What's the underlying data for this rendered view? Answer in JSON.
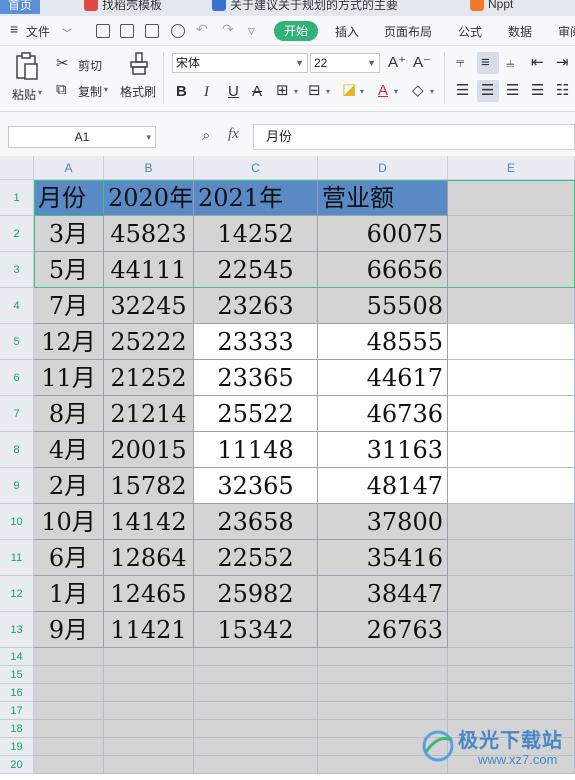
{
  "tabs": [
    {
      "label": "首页",
      "active": true
    },
    {
      "label": "找稻壳模板",
      "active": false
    },
    {
      "label": "关于建议关于规划的方式的主要",
      "active": false
    },
    {
      "label": "Nppt",
      "active": false
    }
  ],
  "menu": {
    "file_label": "文件",
    "items": [
      "开始",
      "插入",
      "页面布局",
      "公式",
      "数据",
      "审阅"
    ]
  },
  "ribbon": {
    "paste_label": "粘贴",
    "cut_label": "剪切",
    "copy_label": "复制",
    "format_painter_label": "格式刷",
    "font_name": "宋体",
    "font_size": "22",
    "bold": "B",
    "italic": "I",
    "underline": "U",
    "strike": "A",
    "font_color_glyph": "A",
    "grow_font": "A⁺",
    "shrink_font": "A⁻"
  },
  "formula_bar": {
    "cell_ref": "A1",
    "fx_label": "fx",
    "content": "月份"
  },
  "sheet": {
    "columns": [
      "A",
      "B",
      "C",
      "D",
      "E"
    ],
    "rows": [
      "1",
      "2",
      "3",
      "4",
      "5",
      "6",
      "7",
      "8",
      "9",
      "10",
      "11",
      "12",
      "13",
      "14",
      "15",
      "16",
      "17",
      "18",
      "19",
      "20"
    ],
    "header": [
      "月份",
      "2020年",
      "2021年",
      "营业额"
    ],
    "data": [
      [
        "3月",
        "45823",
        "14252",
        "60075"
      ],
      [
        "5月",
        "44111",
        "22545",
        "66656"
      ],
      [
        "7月",
        "32245",
        "23263",
        "55508"
      ],
      [
        "12月",
        "25222",
        "23333",
        "48555"
      ],
      [
        "11月",
        "21252",
        "23365",
        "44617"
      ],
      [
        "8月",
        "21214",
        "25522",
        "46736"
      ],
      [
        "4月",
        "20015",
        "11148",
        "31163"
      ],
      [
        "2月",
        "15782",
        "32365",
        "48147"
      ],
      [
        "10月",
        "14142",
        "23658",
        "37800"
      ],
      [
        "6月",
        "12864",
        "22552",
        "35416"
      ],
      [
        "1月",
        "12465",
        "25982",
        "38447"
      ],
      [
        "9月",
        "11421",
        "15342",
        "26763"
      ]
    ]
  },
  "colors": {
    "header_fill": "#5a8ac6",
    "body_fill": "#d4d4d4",
    "accent_green": "#30b27a"
  },
  "watermark": {
    "text": "极光下载站",
    "url": "www.xz7.com"
  }
}
